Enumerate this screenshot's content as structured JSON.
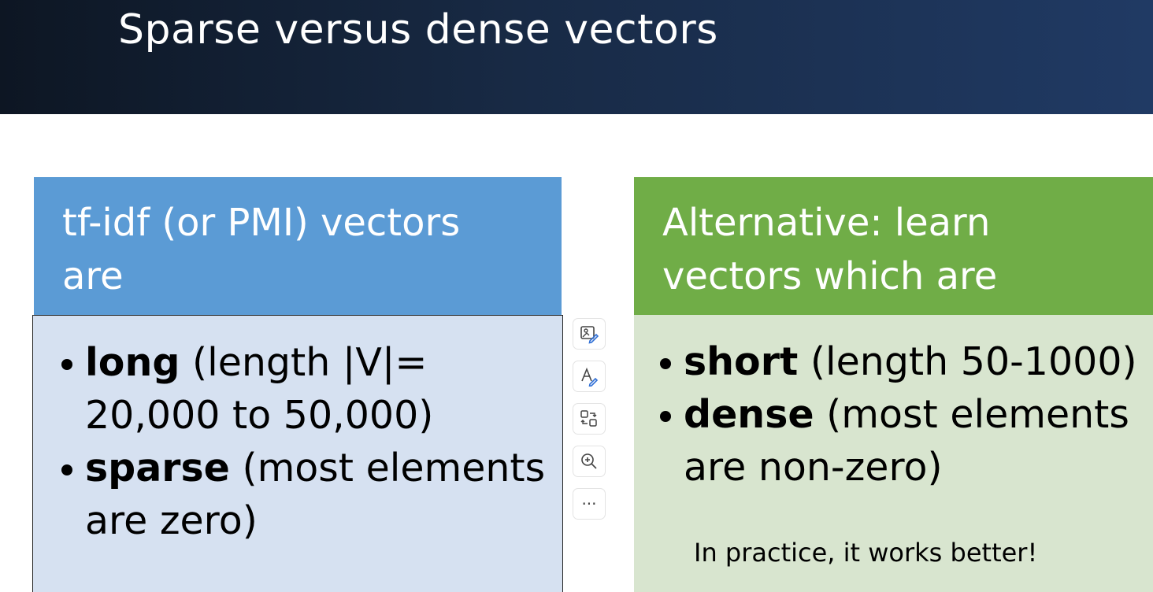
{
  "slide": {
    "title": "Sparse versus dense vectors"
  },
  "left_panel": {
    "heading": "tf-idf (or PMI) vectors are",
    "bullets": [
      {
        "term": "long",
        "detail": " (length |V|= 20,000 to 50,000)"
      },
      {
        "term": "sparse",
        "detail": " (most elements are zero)"
      }
    ],
    "colors": {
      "header": "#5b9bd5",
      "body": "#d6e1f1"
    }
  },
  "right_panel": {
    "heading": "Alternative: learn vectors which are",
    "bullets": [
      {
        "term": "short",
        "detail": " (length 50-1000)"
      },
      {
        "term": "dense",
        "detail": " (most elements are non-zero)"
      }
    ],
    "note": "In practice, it works better!",
    "colors": {
      "header": "#70ad47",
      "body": "#d8e5cf"
    }
  },
  "toolbar": {
    "items": [
      {
        "icon": "image-edit-icon"
      },
      {
        "icon": "text-style-icon"
      },
      {
        "icon": "replace-icon"
      },
      {
        "icon": "zoom-in-icon"
      },
      {
        "icon": "more-icon",
        "glyph": "···"
      }
    ]
  }
}
